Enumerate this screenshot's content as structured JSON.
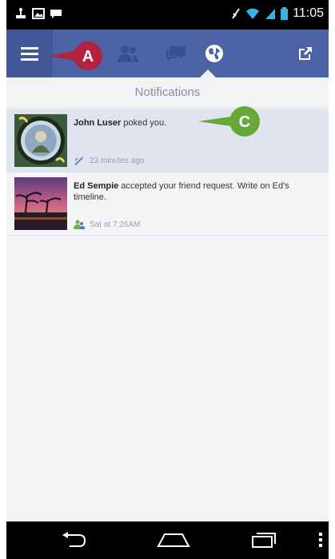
{
  "status_bar": {
    "time": "11:05",
    "icons": [
      "usb-icon",
      "picture-icon",
      "chat-icon",
      "signal-off-icon",
      "wifi-icon",
      "cell-signal-icon",
      "battery-icon"
    ]
  },
  "app_bar": {
    "tabs": [
      "menu-icon",
      "friend-requests-icon",
      "messages-icon",
      "notifications-icon",
      "share-icon"
    ],
    "active_tab": "notifications-icon",
    "color": "#4c63a6"
  },
  "page_title": "Notifications",
  "notifications": [
    {
      "name": "John Luser",
      "text": " poked you.",
      "time": "23 minutes ago",
      "meta_icon": "poke-icon",
      "highlight": "#dfe4ee"
    },
    {
      "name": "Ed Sempie",
      "text": " accepted your friend request. Write on Ed's timeline.",
      "time": "Sat at 7:26AM",
      "meta_icon": "friends-icon",
      "highlight": "#f4f5f7"
    }
  ],
  "callouts": [
    {
      "letter": "A",
      "color": "#b3223f"
    },
    {
      "letter": "C",
      "color": "#6aa73a"
    }
  ],
  "nav_bar": {
    "icons": [
      "back-icon",
      "home-icon",
      "recent-apps-icon",
      "overflow-menu-icon"
    ]
  }
}
